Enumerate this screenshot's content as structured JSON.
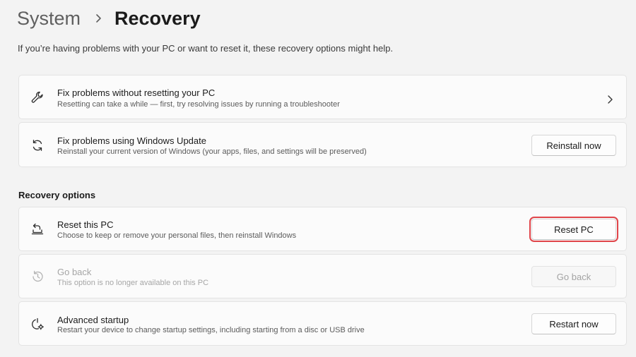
{
  "breadcrumb": {
    "parent": "System",
    "current": "Recovery"
  },
  "intro_text": "If you’re having problems with your PC or want to reset it, these recovery options might help.",
  "cards_top": [
    {
      "title": "Fix problems without resetting your PC",
      "description": "Resetting can take a while — first, try resolving issues by running a troubleshooter",
      "icon": "wrench-icon"
    },
    {
      "title": "Fix problems using Windows Update",
      "description": "Reinstall your current version of Windows (your apps, files, and settings will be preserved)",
      "icon": "sync-icon",
      "button": "Reinstall now"
    }
  ],
  "recovery_options": {
    "heading": "Recovery options",
    "items": [
      {
        "title": "Reset this PC",
        "description": "Choose to keep or remove your personal files, then reinstall Windows",
        "icon": "reset-pc-icon",
        "button": "Reset PC",
        "highlighted": true
      },
      {
        "title": "Go back",
        "description": "This option is no longer available on this PC",
        "icon": "history-icon",
        "button": "Go back",
        "disabled": true
      },
      {
        "title": "Advanced startup",
        "description": "Restart your device to change startup settings, including starting from a disc or USB drive",
        "icon": "advanced-startup-icon",
        "button": "Restart now"
      }
    ]
  },
  "colors": {
    "highlight_outline": "#e0454a",
    "background": "#f3f3f3",
    "card": "#fbfbfb"
  }
}
